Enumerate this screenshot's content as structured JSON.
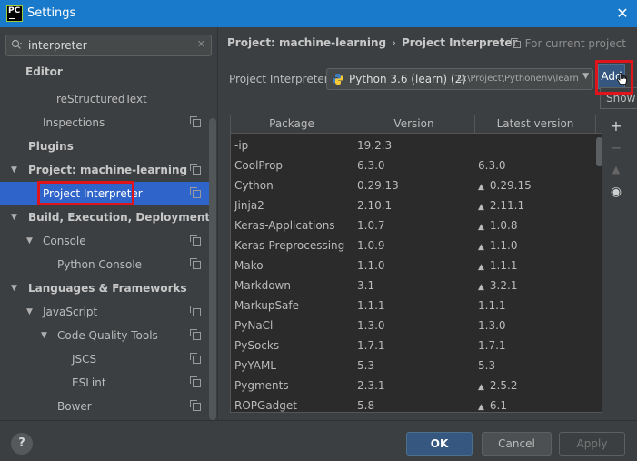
{
  "window": {
    "title": "Settings",
    "app_icon_text": "PC",
    "close_glyph": "✕"
  },
  "search": {
    "value": "interpreter",
    "icon": "search-icon",
    "clear_glyph": "✕"
  },
  "tree": {
    "editor": "Editor",
    "restructured_text": "reStructuredText",
    "inspections": "Inspections",
    "plugins": "Plugins",
    "project": "Project: machine-learning",
    "project_interpreter": "Project Interpreter",
    "build": "Build, Execution, Deployment",
    "console": "Console",
    "python_console": "Python Console",
    "languages": "Languages & Frameworks",
    "javascript": "JavaScript",
    "code_quality": "Code Quality Tools",
    "jscs": "JSCS",
    "eslint": "ESLint",
    "bower": "Bower",
    "expanded_glyph": "▼"
  },
  "main": {
    "breadcrumb_project": "Project: machine-learning",
    "breadcrumb_sep": "›",
    "breadcrumb_page": "Project Interpreter",
    "for_current": "For current project",
    "interpreter_label": "Project Interpreter:",
    "interpreter_name": "Python 3.6 (learn) (2)",
    "interpreter_path": "D:\\Project\\Pythonenv\\learn",
    "add_label": "Add",
    "show_label": "Show"
  },
  "table": {
    "columns": [
      "Package",
      "Version",
      "Latest version"
    ],
    "upgrade_glyph": "▲",
    "rows": [
      {
        "package": "-ip",
        "version": "19.2.3",
        "latest": "",
        "upgrade": false
      },
      {
        "package": "CoolProp",
        "version": "6.3.0",
        "latest": "6.3.0",
        "upgrade": false
      },
      {
        "package": "Cython",
        "version": "0.29.13",
        "latest": "0.29.15",
        "upgrade": true
      },
      {
        "package": "Jinja2",
        "version": "2.10.1",
        "latest": "2.11.1",
        "upgrade": true
      },
      {
        "package": "Keras-Applications",
        "version": "1.0.7",
        "latest": "1.0.8",
        "upgrade": true
      },
      {
        "package": "Keras-Preprocessing",
        "version": "1.0.9",
        "latest": "1.1.0",
        "upgrade": true
      },
      {
        "package": "Mako",
        "version": "1.1.0",
        "latest": "1.1.1",
        "upgrade": true
      },
      {
        "package": "Markdown",
        "version": "3.1",
        "latest": "3.2.1",
        "upgrade": true
      },
      {
        "package": "MarkupSafe",
        "version": "1.1.1",
        "latest": "1.1.1",
        "upgrade": false
      },
      {
        "package": "PyNaCl",
        "version": "1.3.0",
        "latest": "1.3.0",
        "upgrade": false
      },
      {
        "package": "PySocks",
        "version": "1.7.1",
        "latest": "1.7.1",
        "upgrade": false
      },
      {
        "package": "PyYAML",
        "version": "5.3",
        "latest": "5.3",
        "upgrade": false
      },
      {
        "package": "Pygments",
        "version": "2.3.1",
        "latest": "2.5.2",
        "upgrade": true
      },
      {
        "package": "ROPGadget",
        "version": "5.8",
        "latest": "6.1",
        "upgrade": true
      }
    ]
  },
  "tools": {
    "add_glyph": "+",
    "remove_glyph": "−",
    "upgrade_glyph": "▲",
    "show_glyph": "◉"
  },
  "footer": {
    "help": "?",
    "ok": "OK",
    "cancel": "Cancel",
    "apply": "Apply"
  },
  "colors": {
    "accent": "#2f65ca",
    "highlight": "#e0141b",
    "titlebar": "#1979ca"
  }
}
